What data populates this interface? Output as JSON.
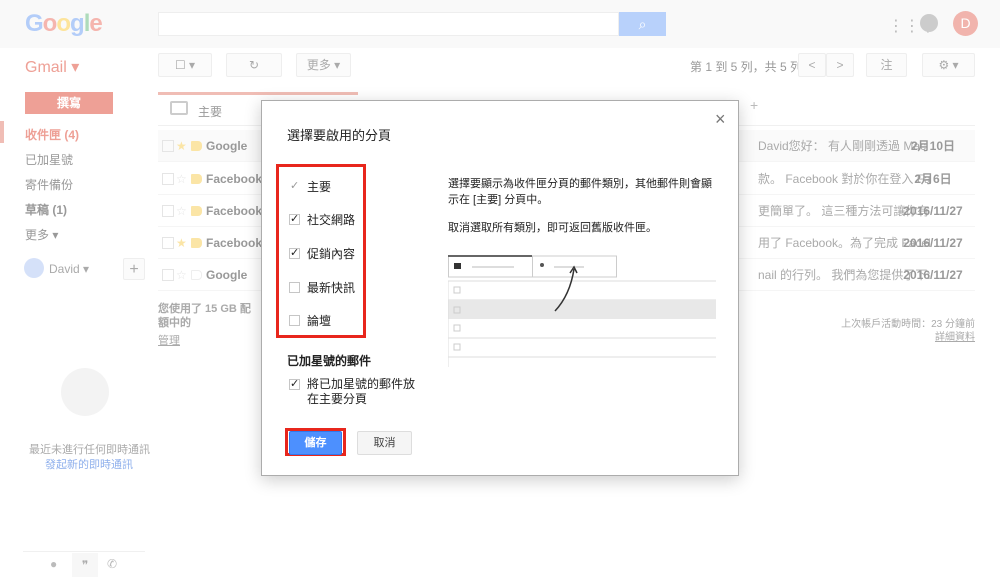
{
  "header": {
    "logo": "Google",
    "search_placeholder": "",
    "avatar_letter": "D"
  },
  "gmail_label": "Gmail ▾",
  "toolbar": {
    "select": "☐ ▾",
    "refresh": "↻",
    "more": "更多 ▾",
    "paging": "第 1 到 5 列，共 5 列",
    "prev": "<",
    "next": ">",
    "input_tool": "注",
    "settings": "⚙ ▾"
  },
  "sidebar": {
    "compose": "撰寫",
    "items": [
      {
        "label": "收件匣 (4)"
      },
      {
        "label": "已加星號"
      },
      {
        "label": "寄件備份"
      },
      {
        "label": "草稿 (1)"
      },
      {
        "label": "更多 ▾"
      }
    ],
    "user": "David ▾",
    "add": "+",
    "hangouts_empty": "最近未進行任何即時通訊",
    "hangouts_start": "發起新的即時通訊"
  },
  "tabs": {
    "primary": "主要",
    "add": "+"
  },
  "emails": [
    {
      "sender": "Google",
      "snippet": "David您好： 有人剛剛透過 Mac",
      "date": "2月10日",
      "starred": true
    },
    {
      "sender": "Facebook",
      "snippet": "款。 Facebook 對於你在登入 Fa",
      "date": "2月6日",
      "starred": false
    },
    {
      "sender": "Facebook",
      "snippet": "更簡單了。 這三種方法可讓你有",
      "date": "2016/11/27",
      "starred": false
    },
    {
      "sender": "Facebook",
      "snippet": "用了 Facebook。為了完成 Facel",
      "date": "2016/11/27",
      "starred": true
    },
    {
      "sender": "Google",
      "snippet": "nail 的行列。 我們為您提供了下:",
      "date": "2016/11/27",
      "starred": false
    }
  ],
  "footer": {
    "storage": "您使用了 15 GB 配額中的",
    "manage": "管理",
    "activity": "上次帳戶活動時間：23 分鐘前",
    "details": "詳細資料"
  },
  "dialog": {
    "title": "選擇要啟用的分頁",
    "close": "×",
    "categories": [
      {
        "label": "主要",
        "checked": true,
        "disabled": true
      },
      {
        "label": "社交網路",
        "checked": true
      },
      {
        "label": "促銷內容",
        "checked": true
      },
      {
        "label": "最新快訊",
        "checked": false
      },
      {
        "label": "論壇",
        "checked": false
      }
    ],
    "starred_heading": "已加星號的郵件",
    "starred_option": {
      "label": "將已加星號的郵件放在主要分頁",
      "checked": true
    },
    "desc1": "選擇要顯示為收件匣分頁的郵件類別，其他郵件則會顯示在 [主要] 分頁中。",
    "desc2": "取消選取所有類別，即可返回舊版收件匣。",
    "save": "儲存",
    "cancel": "取消"
  },
  "colors": {
    "accent": "#4d90fe",
    "highlight": "#e8261c",
    "gmail_red": "#dd4b39"
  }
}
